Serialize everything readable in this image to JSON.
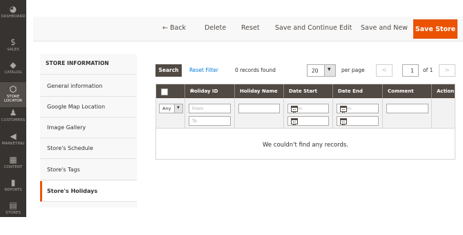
{
  "admin_nav": {
    "items": [
      {
        "label": "DASHBOARD",
        "icon": "dashboard-icon",
        "glyph": "◕"
      },
      {
        "label": "SALES",
        "icon": "dollar-icon",
        "glyph": "$"
      },
      {
        "label": "CATALOG",
        "icon": "cube-icon",
        "glyph": "◆"
      },
      {
        "label": "STORE LOCATOR",
        "icon": "hexagon-icon",
        "glyph": "⬡"
      },
      {
        "label": "CUSTOMERS",
        "icon": "person-icon",
        "glyph": "♟"
      },
      {
        "label": "MARKETING",
        "icon": "megaphone-icon",
        "glyph": "◀"
      },
      {
        "label": "CONTENT",
        "icon": "content-icon",
        "glyph": "▦"
      },
      {
        "label": "REPORTS",
        "icon": "bar-chart-icon",
        "glyph": "▮"
      },
      {
        "label": "STORES",
        "icon": "store-icon",
        "glyph": "▤"
      }
    ],
    "active": "STORE LOCATOR"
  },
  "actions": {
    "back": "← Back",
    "delete": "Delete",
    "reset": "Reset",
    "save_continue": "Save and Continue Edit",
    "save_new": "Save and New",
    "save_store": "Save Store"
  },
  "store_info": {
    "heading": "STORE INFORMATION",
    "items": [
      "General information",
      "Google Map Location",
      "Image Gallery",
      "Store's Schedule",
      "Store's Tags",
      "Store's Holidays"
    ],
    "active": "Store's Holidays"
  },
  "grid_toolbar": {
    "search": "Search",
    "reset_filter": "Reset Filter",
    "records": "0 records found",
    "per_page_value": "20",
    "per_page_label": "per page",
    "prev": "<",
    "page": "1",
    "of": "of 1",
    "next": ">"
  },
  "grid": {
    "columns": [
      "",
      "Holiday ID",
      "Holiday Name",
      "Date Start",
      "Date End",
      "Comment",
      "Action"
    ],
    "sort_indicator": "↓",
    "filters": {
      "select_value": "Any",
      "from_placeholder": "From",
      "to_placeholder": "To"
    },
    "empty_message": "We couldn't find any records."
  },
  "colors": {
    "accent": "#eb5202",
    "nav_bg": "#373330",
    "header_bg": "#514943",
    "link": "#007bdb"
  }
}
